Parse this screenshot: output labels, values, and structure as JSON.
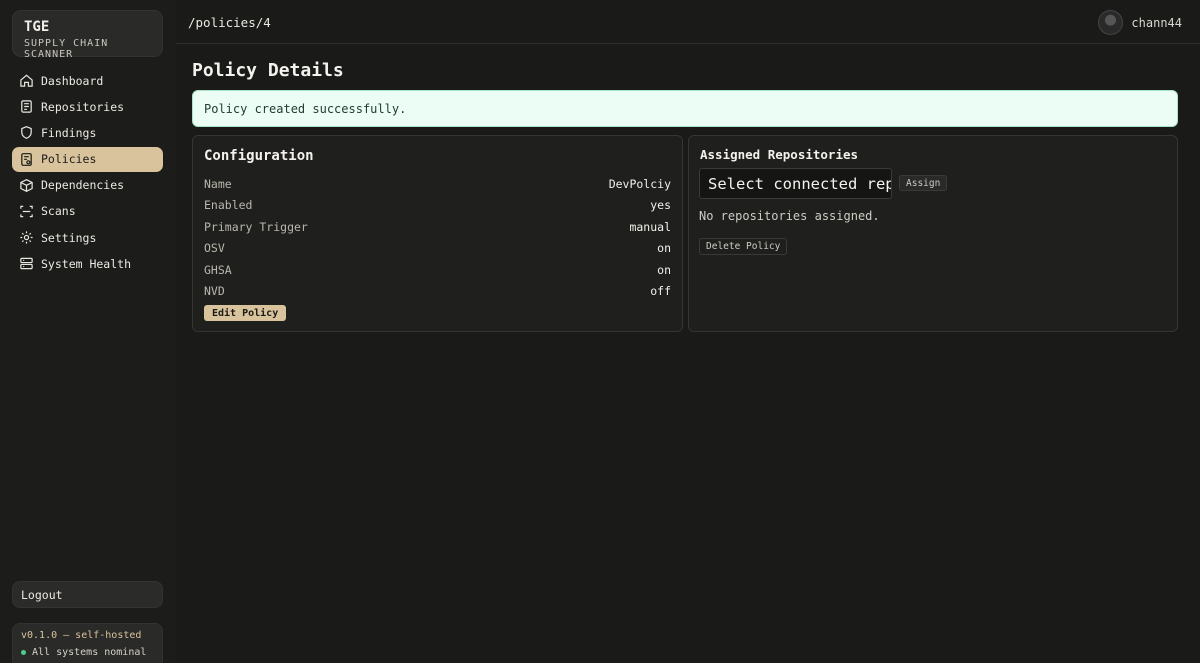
{
  "brand": {
    "title": "TGE",
    "subtitle": "SUPPLY CHAIN SCANNER"
  },
  "nav": {
    "items": [
      {
        "label": "Dashboard",
        "icon": "home-icon",
        "active": false
      },
      {
        "label": "Repositories",
        "icon": "repository-icon",
        "active": false
      },
      {
        "label": "Findings",
        "icon": "shield-icon",
        "active": false
      },
      {
        "label": "Policies",
        "icon": "policy-icon",
        "active": true
      },
      {
        "label": "Dependencies",
        "icon": "box-icon",
        "active": false
      },
      {
        "label": "Scans",
        "icon": "scan-icon",
        "active": false
      },
      {
        "label": "Settings",
        "icon": "gear-icon",
        "active": false
      },
      {
        "label": "System Health",
        "icon": "server-icon",
        "active": false
      }
    ],
    "logout_label": "Logout"
  },
  "footer": {
    "version": "v0.1.0 — self-hosted",
    "status": "All systems nominal",
    "status_color": "#4fcf8a"
  },
  "header": {
    "path": "/policies/4",
    "username": "chann44"
  },
  "page": {
    "title": "Policy Details",
    "alert": "Policy created successfully."
  },
  "config": {
    "title": "Configuration",
    "rows": [
      {
        "key": "Name",
        "value": "DevPolciy"
      },
      {
        "key": "Enabled",
        "value": "yes"
      },
      {
        "key": "Primary Trigger",
        "value": "manual"
      },
      {
        "key": "OSV",
        "value": "on"
      },
      {
        "key": "GHSA",
        "value": "on"
      },
      {
        "key": "NVD",
        "value": "off"
      }
    ],
    "edit_label": "Edit Policy"
  },
  "assigned": {
    "title": "Assigned Repositories",
    "select_value": "Select connected repo",
    "assign_label": "Assign",
    "empty_text": "No repositories assigned.",
    "delete_label": "Delete Policy"
  },
  "colors": {
    "accent": "#d8c39c",
    "background": "#1a1a18",
    "alert_bg": "#ecfdf5"
  }
}
